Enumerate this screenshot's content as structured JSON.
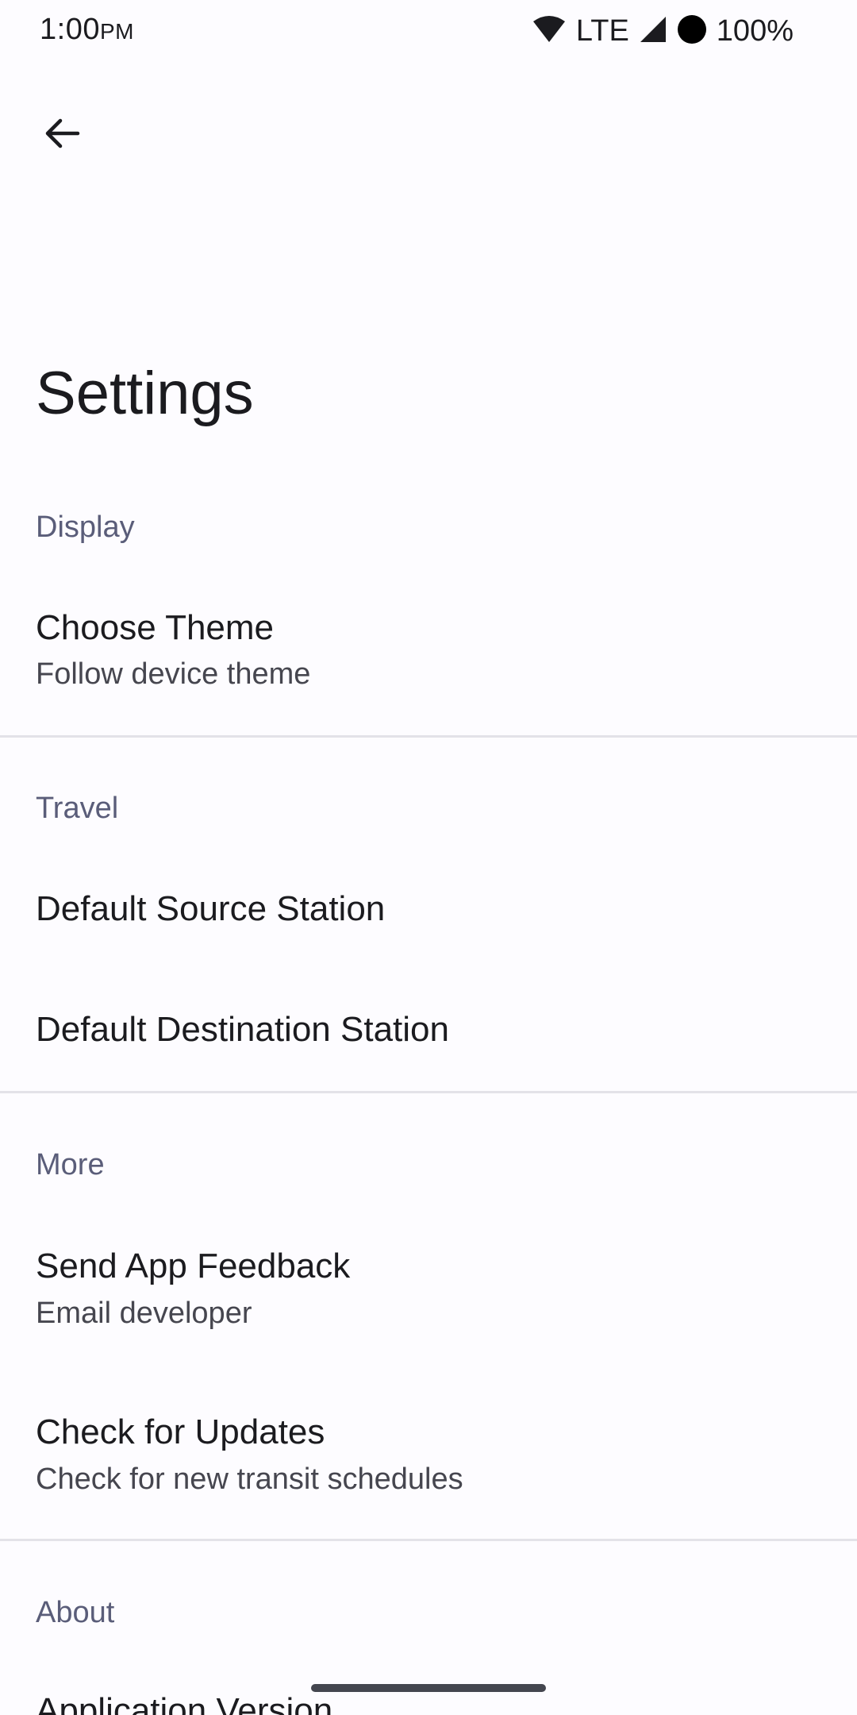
{
  "status_bar": {
    "time": "1:00",
    "ampm": "PM",
    "network": "LTE",
    "battery": "100%"
  },
  "app_bar": {
    "back_icon": "arrow-back-icon",
    "title": "Settings"
  },
  "sections": {
    "display": {
      "header": "Display",
      "choose_theme": {
        "title": "Choose Theme",
        "summary": "Follow device theme"
      }
    },
    "travel": {
      "header": "Travel",
      "default_source": {
        "title": "Default Source Station"
      },
      "default_destination": {
        "title": "Default Destination Station"
      }
    },
    "more": {
      "header": "More",
      "send_feedback": {
        "title": "Send App Feedback",
        "summary": "Email developer"
      },
      "check_updates": {
        "title": "Check for Updates",
        "summary": "Check for new transit schedules"
      }
    },
    "about": {
      "header": "About",
      "app_version": {
        "title": "Application Version"
      }
    }
  },
  "colors": {
    "background": "#fdfcff",
    "section_header": "#5a5d79",
    "title_text": "#1b1b1f",
    "summary_text": "#46464f",
    "divider": "#e3e2e8"
  }
}
